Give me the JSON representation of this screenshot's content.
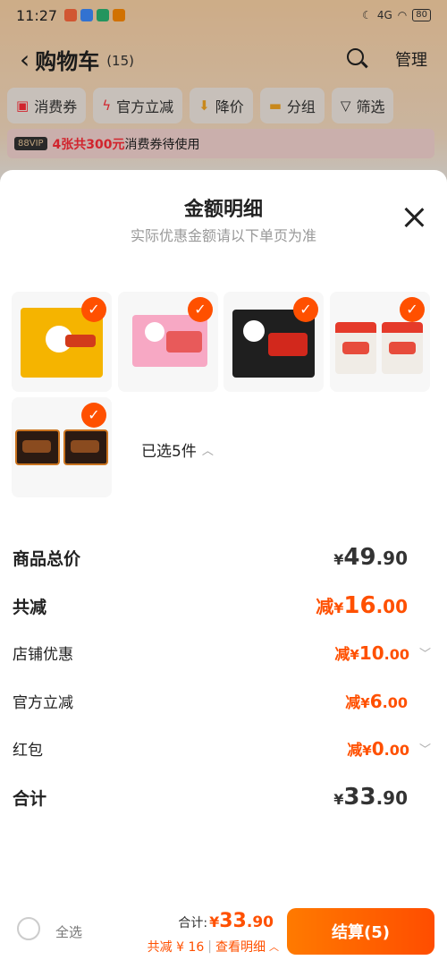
{
  "status_bar": {
    "time": "11:27",
    "signal": "4G",
    "battery": "80"
  },
  "header": {
    "title": "购物车",
    "count": "(15)",
    "manage_label": "管理"
  },
  "filters": [
    {
      "label": "消费券",
      "icon": "voucher-icon"
    },
    {
      "label": "官方立减",
      "icon": "lightning-icon"
    },
    {
      "label": "降价",
      "icon": "price-drop-icon"
    },
    {
      "label": "分组",
      "icon": "folder-icon"
    },
    {
      "label": "筛选",
      "icon": "filter-icon"
    }
  ],
  "voucher_bar": {
    "vip": "88VIP",
    "highlight": "4张共300元",
    "text": "消费券待使用"
  },
  "sheet": {
    "title": "金额明细",
    "subtitle": "实际优惠金额请以下单页为准",
    "selected_count": "已选5件",
    "rows": [
      {
        "label": "商品总价",
        "prefix": "",
        "currency": "¥",
        "integer": "49",
        "decimal": ".90"
      },
      {
        "label": "共减",
        "prefix": "减",
        "currency": "¥",
        "integer": "16",
        "decimal": ".00"
      },
      {
        "label": "店铺优惠",
        "prefix": "减",
        "currency": "¥",
        "integer": "10",
        "decimal": ".00"
      },
      {
        "label": "官方立减",
        "prefix": "减",
        "currency": "¥",
        "integer": "6",
        "decimal": ".00"
      },
      {
        "label": "红包",
        "prefix": "减",
        "currency": "¥",
        "integer": "0",
        "decimal": ".00"
      },
      {
        "label": "合计",
        "prefix": "",
        "currency": "¥",
        "integer": "33",
        "decimal": ".90"
      }
    ]
  },
  "bottom_bar": {
    "select_all": "全选",
    "total_label": "合计:",
    "total_currency": "¥",
    "total_integer": "33",
    "total_decimal": ".90",
    "saving": "共减 ¥ 16",
    "details_link": "查看明细",
    "checkout": "结算(5)"
  },
  "colors": {
    "accent": "#ff5000",
    "voucher_red": "#ff2d38"
  }
}
